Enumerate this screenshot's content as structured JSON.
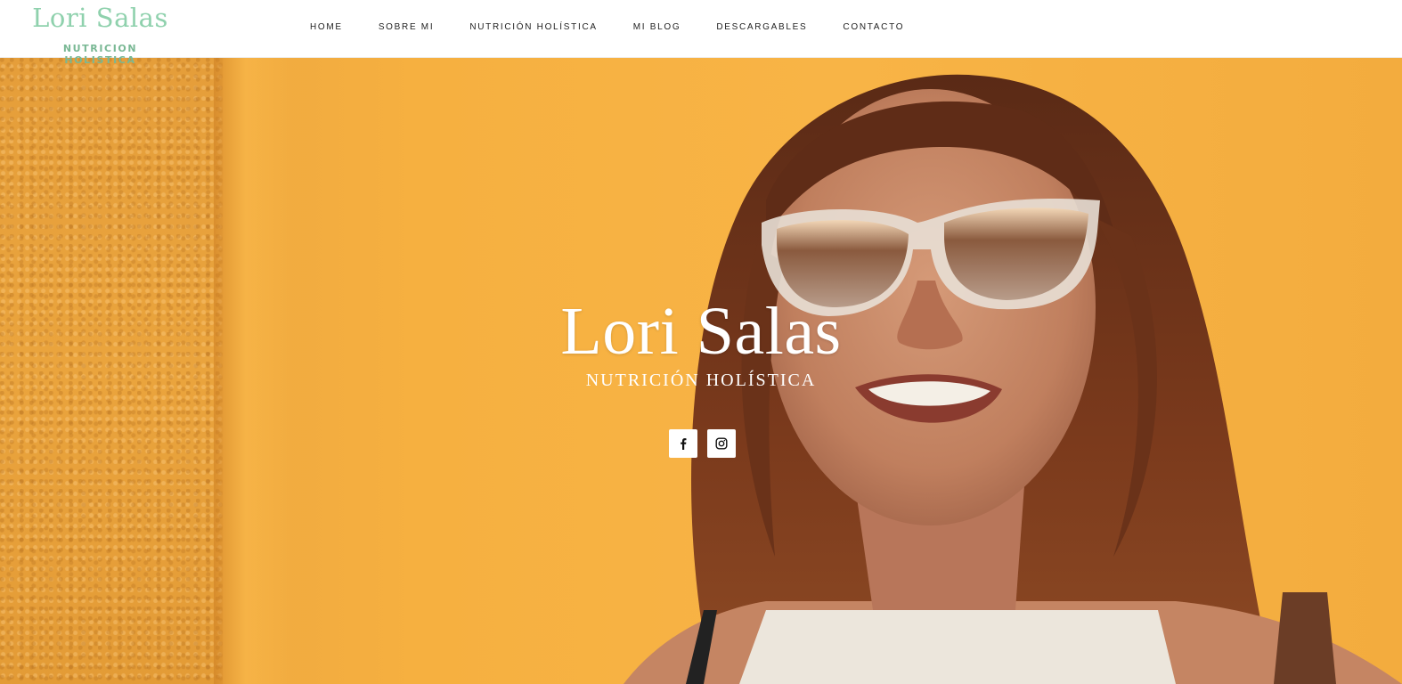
{
  "header": {
    "logo": {
      "name": "Lori Salas",
      "tagline": "NUTRICION HOLISTICA"
    },
    "nav": [
      {
        "label": "HOME"
      },
      {
        "label": "SOBRE MI"
      },
      {
        "label": "NUTRICIÓN HOLÍSTICA"
      },
      {
        "label": "MI BLOG"
      },
      {
        "label": "DESCARGABLES"
      },
      {
        "label": "CONTACTO"
      }
    ]
  },
  "hero": {
    "title": "Lori Salas",
    "subtitle": "NUTRICIÓN HOLÍSTICA",
    "socials": [
      {
        "icon": "facebook-icon"
      },
      {
        "icon": "instagram-icon"
      }
    ]
  },
  "colors": {
    "brand": "#8fd1ad",
    "hero_background": "#f6b040",
    "text_dark": "#222222"
  }
}
